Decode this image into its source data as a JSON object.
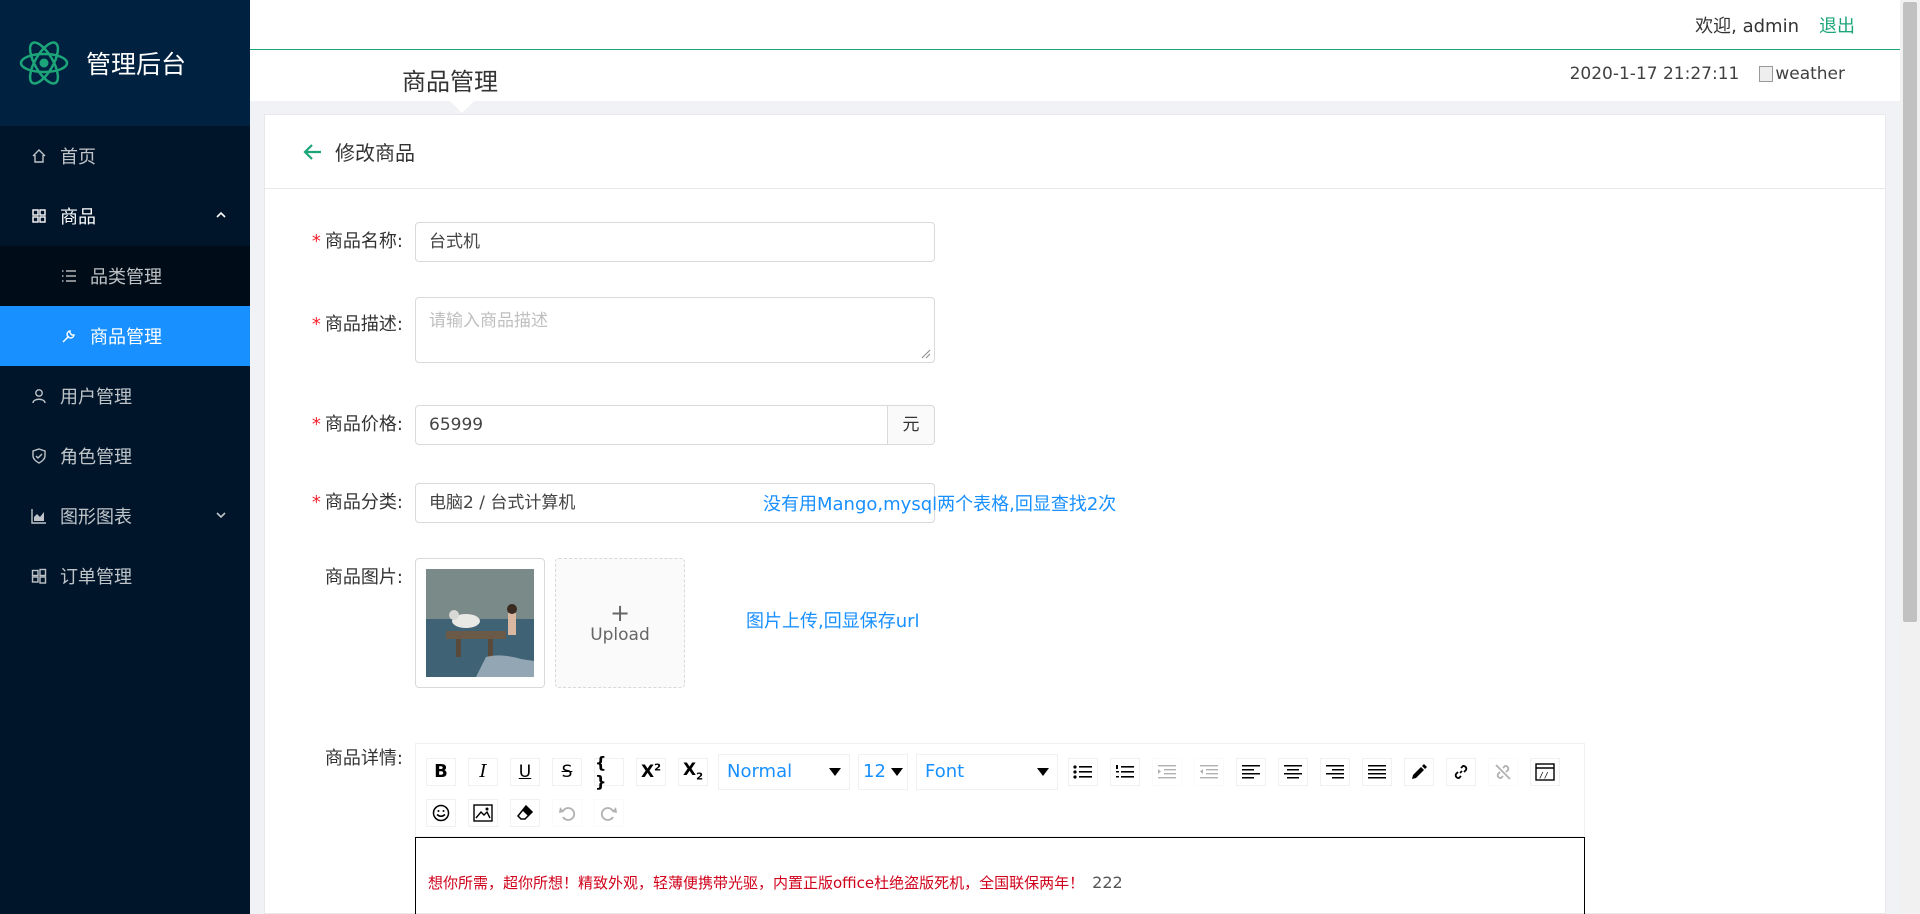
{
  "app": {
    "title": "管理后台"
  },
  "menu": {
    "home": "首页",
    "products": "商品",
    "category_mgmt": "品类管理",
    "product_mgmt": "商品管理",
    "user_mgmt": "用户管理",
    "role_mgmt": "角色管理",
    "charts": "图形图表",
    "order_mgmt": "订单管理"
  },
  "header": {
    "welcome": "欢迎, admin",
    "logout": "退出",
    "page_title": "商品管理",
    "datetime": "2020-1-17 21:27:11",
    "weather_alt": "weather"
  },
  "card": {
    "title": "修改商品"
  },
  "form": {
    "name_label": "商品名称:",
    "name_value": "台式机",
    "desc_label": "商品描述:",
    "desc_placeholder": "请输入商品描述",
    "price_label": "商品价格:",
    "price_value": "65999",
    "price_unit": "元",
    "category_label": "商品分类:",
    "category_value": "电脑2 / 台式计算机",
    "category_note": "没有用Mango,mysql两个表格,回显查找2次",
    "image_label": "商品图片:",
    "upload_label": "Upload",
    "image_note": "图片上传,回显保存url",
    "detail_label": "商品详情:"
  },
  "editor": {
    "block_type": "Normal",
    "font_size": "12",
    "font_family": "Font",
    "content_text": "想你所需，超你所想！精致外观，轻薄便携带光驱，内置正版office杜绝盗版死机，全国联保两年！",
    "content_extra": "222"
  },
  "colors": {
    "accent": "#1da57a",
    "primary": "#1890ff",
    "sidebar": "#001529"
  }
}
